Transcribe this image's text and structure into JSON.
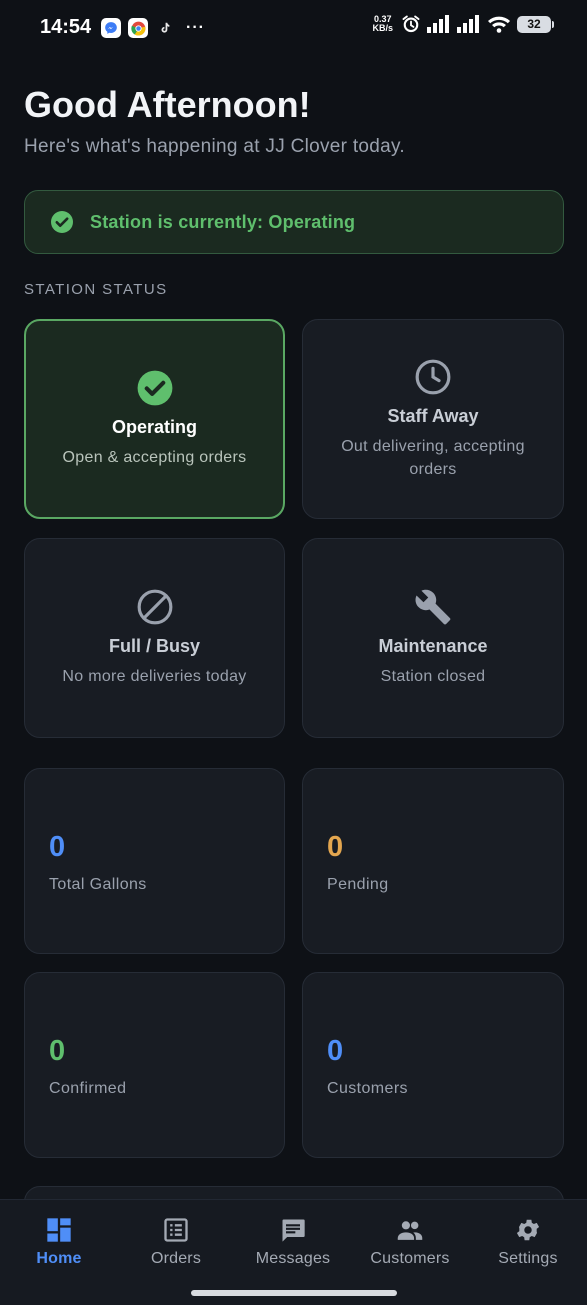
{
  "status_bar": {
    "time": "14:54",
    "more": "···",
    "net_speed_value": "0.37",
    "net_speed_unit": "KB/s",
    "battery": "32"
  },
  "header": {
    "greeting": "Good Afternoon!",
    "subtitle": "Here's what's happening at JJ Clover today."
  },
  "banner": {
    "text": "Station is currently: Operating",
    "color": "#5fbf6d"
  },
  "station_status": {
    "section_label": "STATION STATUS",
    "options": [
      {
        "title": "Operating",
        "desc": "Open & accepting orders",
        "icon": "check-circle-icon",
        "selected": true
      },
      {
        "title": "Staff Away",
        "desc": "Out delivering, accepting orders",
        "icon": "clock-icon",
        "selected": false
      },
      {
        "title": "Full / Busy",
        "desc": "No more deliveries today",
        "icon": "block-icon",
        "selected": false
      },
      {
        "title": "Maintenance",
        "desc": "Station closed",
        "icon": "wrench-icon",
        "selected": false
      }
    ]
  },
  "stats": [
    {
      "value": "0",
      "label": "Total Gallons",
      "color": "#4f8ef7"
    },
    {
      "value": "0",
      "label": "Pending",
      "color": "#e3a64f"
    },
    {
      "value": "0",
      "label": "Confirmed",
      "color": "#5fbf6d"
    },
    {
      "value": "0",
      "label": "Customers",
      "color": "#4f8ef7"
    }
  ],
  "nav": [
    {
      "label": "Home",
      "icon": "dashboard-icon",
      "active": true
    },
    {
      "label": "Orders",
      "icon": "receipt-icon",
      "active": false
    },
    {
      "label": "Messages",
      "icon": "chat-icon",
      "active": false
    },
    {
      "label": "Customers",
      "icon": "people-icon",
      "active": false
    },
    {
      "label": "Settings",
      "icon": "gear-icon",
      "active": false
    }
  ],
  "colors": {
    "background": "#0e1116",
    "card": "#181c23",
    "accent_green": "#5fbf6d",
    "accent_blue": "#4f8ef7"
  }
}
